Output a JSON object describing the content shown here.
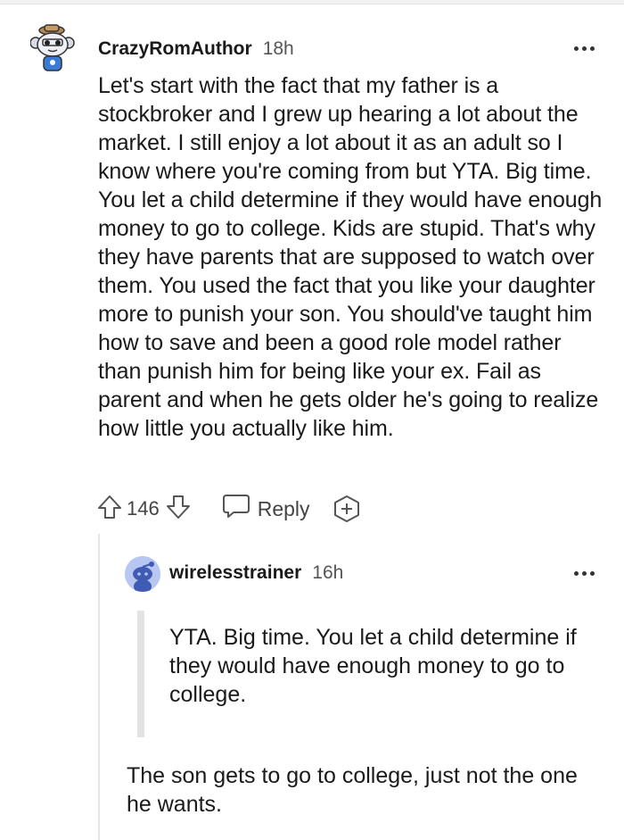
{
  "comment": {
    "username": "CrazyRomAuthor",
    "time": "18h",
    "body": "Let's start with the fact that my father is a stockbroker and I grew up hearing a lot about the market. I still enjoy a lot about it as an adult so I know where you're coming from but YTA. Big time. You let a child determine if they would have enough money to go to college. Kids are stupid. That's why they have parents that are supposed to watch over them. You used the fact that you like your daughter more to punish your son. You should've taught him how to save and been a good role model rather than punish him for being like your ex. Fail as parent and when he gets older he's going to realize how little you actually like him.",
    "votes": "146",
    "reply_label": "Reply",
    "icons": {
      "avatar": "snoo-avatar-icon",
      "upvote": "arrow-up-icon",
      "downvote": "arrow-down-icon",
      "reply": "speech-bubble-icon",
      "award": "award-plus-icon",
      "more": "more-options-icon"
    }
  },
  "reply": {
    "username": "wirelesstrainer",
    "time": "16h",
    "quote": "YTA. Big time. You let a child determine if they would have enough money to go to college.",
    "body": "The son gets to go to college, just not the one he wants."
  },
  "colors": {
    "text": "#1a1a1b",
    "meta": "#555555",
    "quote_bar": "#e3e3e3",
    "avatar_bg": "#b8c6f2"
  }
}
